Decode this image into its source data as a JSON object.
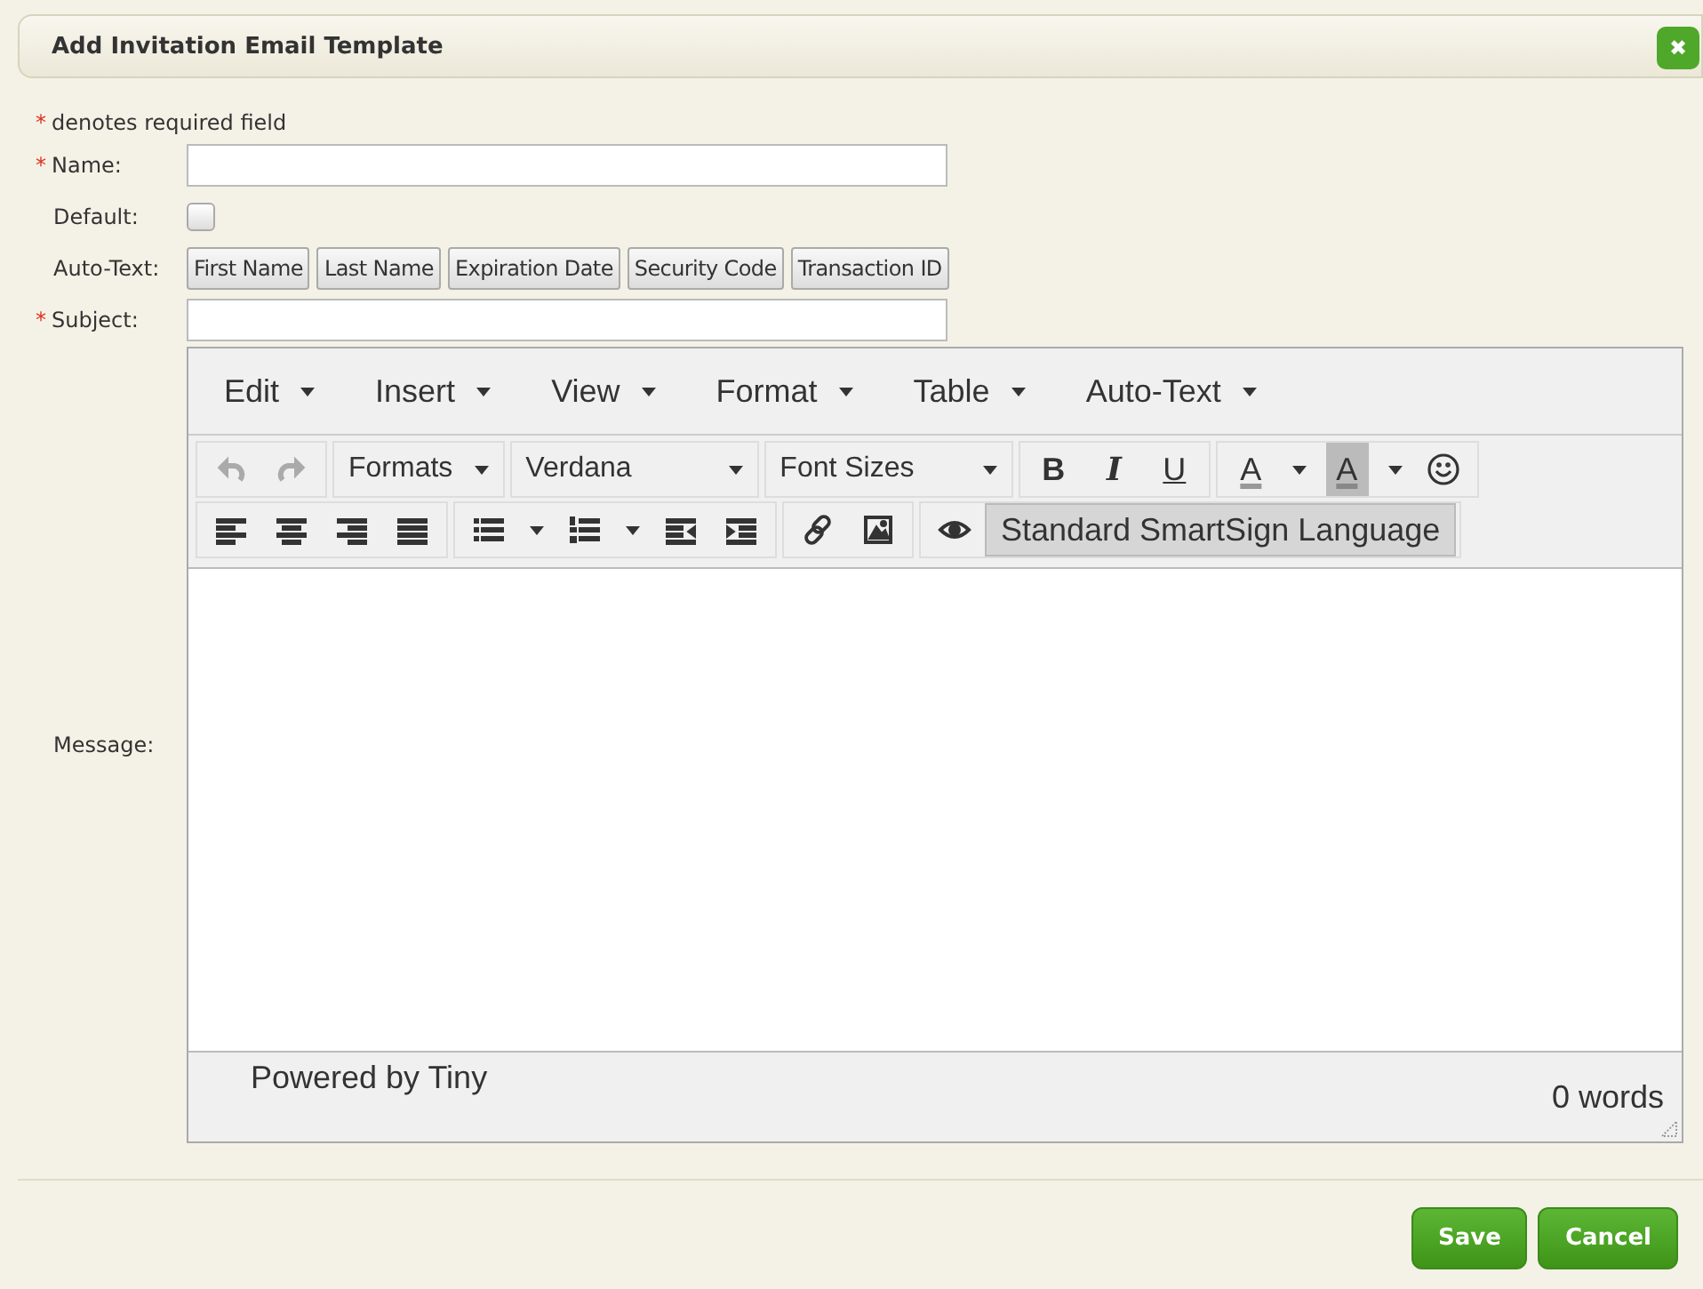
{
  "dialog": {
    "title": "Add Invitation Email Template",
    "close_label": "✖"
  },
  "required_note": {
    "mark": "*",
    "text": "denotes required field"
  },
  "fields": [
    {
      "kind": "text",
      "mark": "*",
      "label": "Name:"
    },
    {
      "kind": "checkbox",
      "label": "Default:",
      "checked": false
    },
    {
      "kind": "autotext",
      "label": "Auto-Text:",
      "buttons": [
        "First Name",
        "Last Name",
        "Expiration Date",
        "Security Code",
        "Transaction ID"
      ]
    },
    {
      "kind": "text",
      "mark": "*",
      "label": "Subject:"
    }
  ],
  "message_label": "Message:",
  "editor": {
    "menus": [
      "Edit",
      "Insert",
      "View",
      "Format",
      "Table",
      "Auto-Text"
    ],
    "toolbar_rows": [
      [
        [
          {
            "kind": "undo",
            "disabled": true
          },
          {
            "kind": "redo",
            "disabled": true
          }
        ],
        [
          {
            "kind": "select",
            "label": "Formats",
            "wide": false
          }
        ],
        [
          {
            "kind": "select",
            "label": "Verdana",
            "wide": true
          }
        ],
        [
          {
            "kind": "select",
            "label": "Font Sizes",
            "wide": true
          }
        ],
        [
          {
            "kind": "bold",
            "label": "B"
          },
          {
            "kind": "italic",
            "label": "I"
          },
          {
            "kind": "underline",
            "label": "U"
          }
        ],
        [
          {
            "kind": "forecolor",
            "label": "A"
          },
          {
            "kind": "caret"
          },
          {
            "kind": "backcolor",
            "label": "A"
          },
          {
            "kind": "caret"
          },
          {
            "kind": "emoticon"
          }
        ]
      ],
      [
        [
          {
            "kind": "align-left"
          },
          {
            "kind": "align-center"
          },
          {
            "kind": "align-right"
          },
          {
            "kind": "justify"
          }
        ],
        [
          {
            "kind": "bullets"
          },
          {
            "kind": "caret"
          },
          {
            "kind": "numbers"
          },
          {
            "kind": "caret"
          },
          {
            "kind": "outdent"
          },
          {
            "kind": "indent"
          }
        ],
        [
          {
            "kind": "link"
          },
          {
            "kind": "image"
          }
        ],
        [
          {
            "kind": "preview"
          },
          {
            "kind": "style",
            "label": "Standard SmartSign Language"
          }
        ]
      ]
    ],
    "branding": "Powered by Tiny",
    "word_count": "0 words"
  },
  "buttons": [
    {
      "label": "Save"
    },
    {
      "label": "Cancel"
    }
  ]
}
